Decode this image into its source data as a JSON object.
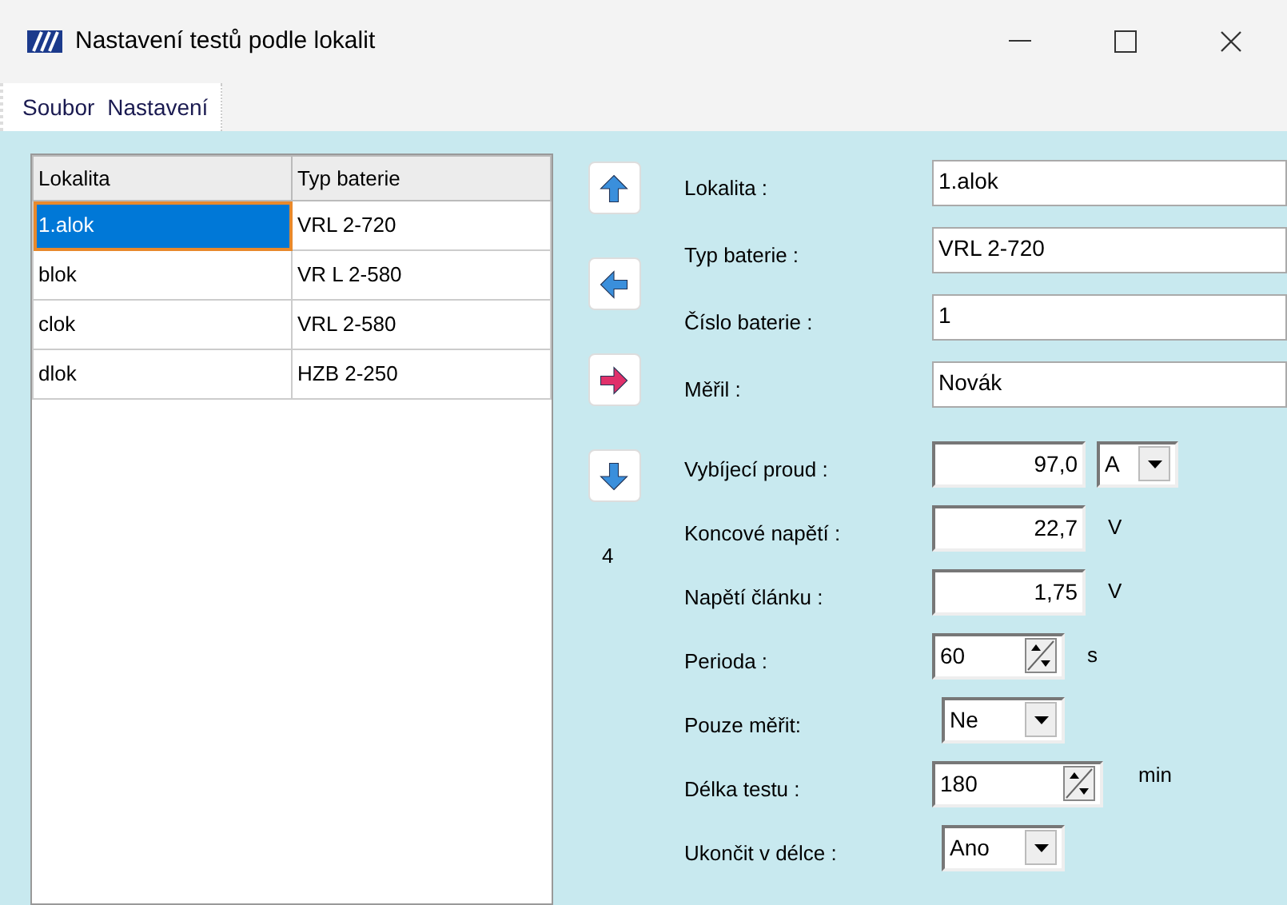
{
  "window": {
    "title": "Nastavení testů podle lokalit"
  },
  "menu": [
    "Soubor",
    "Nastavení"
  ],
  "table": {
    "columns": [
      "Lokalita",
      "Typ baterie"
    ],
    "rows": [
      {
        "cells": [
          "1.alok",
          "VRL 2-720"
        ],
        "selected": true
      },
      {
        "cells": [
          "blok",
          "VR L 2-580"
        ],
        "selected": false
      },
      {
        "cells": [
          "clok",
          "VRL 2-580"
        ],
        "selected": false
      },
      {
        "cells": [
          "dlok",
          "HZB 2-250"
        ],
        "selected": false
      }
    ]
  },
  "nav_buttons": [
    {
      "kind": "up"
    },
    {
      "kind": "left"
    },
    {
      "kind": "right"
    },
    {
      "kind": "down"
    }
  ],
  "record_count": "4",
  "record_fields": [
    {
      "label": "Lokalita :",
      "value": "1.alok"
    },
    {
      "label": "Typ baterie :",
      "value": "VRL 2-720"
    },
    {
      "label": "Číslo baterie :",
      "value": "1"
    },
    {
      "label": "Měřil :",
      "value": "Novák"
    }
  ],
  "test_settings": [
    {
      "kind": "number",
      "label": "Vybíjecí proud :",
      "value": "97,0",
      "unit_select": "A"
    },
    {
      "kind": "number",
      "label": "Koncové napětí :",
      "value": "22,7",
      "unit": "V"
    },
    {
      "kind": "number",
      "label": "Napětí článku :",
      "value": "1,75",
      "unit": "V"
    },
    {
      "kind": "spinner",
      "label": "Perioda :",
      "value": "60",
      "unit": "s"
    },
    {
      "kind": "select",
      "label": "Pouze měřit:",
      "value": "Ne"
    },
    {
      "kind": "spinner_wide",
      "label": "Délka testu :",
      "value": "180",
      "unit": "min"
    },
    {
      "kind": "select",
      "label": "Ukončit v délce :",
      "value": "Ano"
    }
  ]
}
